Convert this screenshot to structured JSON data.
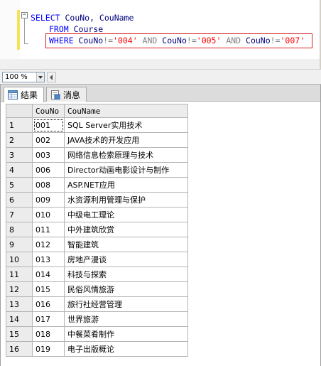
{
  "editor": {
    "line1": {
      "select": "SELECT",
      "cols": " CouNo, CouName"
    },
    "line2": {
      "from": "FROM",
      "table": " Course"
    },
    "line3": {
      "where": "WHERE",
      "c1": " CouNo",
      "op1": "!=",
      "v1": "'004'",
      "and1": " AND",
      "c2": " CouNo",
      "op2": "!=",
      "v2": "'005'",
      "and2": " AND",
      "c3": " CouNo",
      "op3": "!=",
      "v3": "'007'"
    },
    "fold_symbol": "−"
  },
  "zoom": {
    "value": "100 %"
  },
  "tabs": [
    {
      "label": "结果",
      "icon": "grid-results-icon"
    },
    {
      "label": "消息",
      "icon": "messages-icon"
    }
  ],
  "grid": {
    "columns": [
      "CouNo",
      "CouName"
    ],
    "rows": [
      {
        "n": "1",
        "CouNo": "001",
        "CouName": "SQL Server实用技术"
      },
      {
        "n": "2",
        "CouNo": "002",
        "CouName": "JAVA技术的开发应用"
      },
      {
        "n": "3",
        "CouNo": "003",
        "CouName": "网络信息检索原理与技术"
      },
      {
        "n": "4",
        "CouNo": "006",
        "CouName": "Director动画电影设计与制作"
      },
      {
        "n": "5",
        "CouNo": "008",
        "CouName": "ASP.NET应用"
      },
      {
        "n": "6",
        "CouNo": "009",
        "CouName": "水资源利用管理与保护"
      },
      {
        "n": "7",
        "CouNo": "010",
        "CouName": "中级电工理论"
      },
      {
        "n": "8",
        "CouNo": "011",
        "CouName": "中外建筑欣赏"
      },
      {
        "n": "9",
        "CouNo": "012",
        "CouName": "智能建筑"
      },
      {
        "n": "10",
        "CouNo": "013",
        "CouName": "房地产漫谈"
      },
      {
        "n": "11",
        "CouNo": "014",
        "CouName": "科技与探索"
      },
      {
        "n": "12",
        "CouNo": "015",
        "CouName": "民俗风情旅游"
      },
      {
        "n": "13",
        "CouNo": "016",
        "CouName": "旅行社经营管理"
      },
      {
        "n": "14",
        "CouNo": "017",
        "CouName": "世界旅游"
      },
      {
        "n": "15",
        "CouNo": "018",
        "CouName": "中餐菜肴制作"
      },
      {
        "n": "16",
        "CouNo": "019",
        "CouName": "电子出版概论"
      }
    ]
  },
  "colors": {
    "keyword": "#0000ff",
    "string": "#ff0000",
    "identifier": "#000080",
    "highlight_border": "#d42020"
  }
}
